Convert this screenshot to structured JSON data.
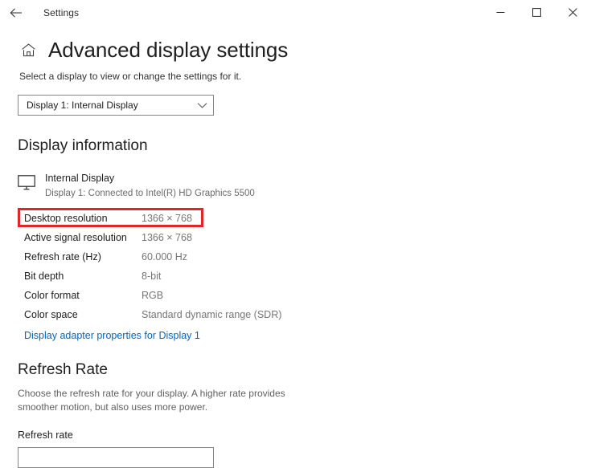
{
  "titlebar": {
    "back_icon": "back-arrow-icon",
    "app_title": "Settings",
    "minimize_label": "minimize-icon",
    "maximize_label": "maximize-icon",
    "close_label": "close-icon"
  },
  "header": {
    "home_icon": "home-icon",
    "title": "Advanced display settings",
    "subtitle": "Select a display to view or change the settings for it."
  },
  "display_selector": {
    "value": "Display 1: Internal Display",
    "chevron_icon": "chevron-down-icon"
  },
  "display_information": {
    "heading": "Display information",
    "monitor_icon": "monitor-icon",
    "display_name": "Internal Display",
    "connection": "Display 1: Connected to Intel(R) HD Graphics 5500",
    "rows": [
      {
        "label": "Desktop resolution",
        "value": "1366 × 768",
        "highlighted": true
      },
      {
        "label": "Active signal resolution",
        "value": "1366 × 768",
        "highlighted": false
      },
      {
        "label": "Refresh rate (Hz)",
        "value": "60.000 Hz",
        "highlighted": false
      },
      {
        "label": "Bit depth",
        "value": "8-bit",
        "highlighted": false
      },
      {
        "label": "Color format",
        "value": "RGB",
        "highlighted": false
      },
      {
        "label": "Color space",
        "value": "Standard dynamic range (SDR)",
        "highlighted": false
      }
    ],
    "adapter_link": "Display adapter properties for Display 1"
  },
  "refresh_rate": {
    "heading": "Refresh Rate",
    "description": "Choose the refresh rate for your display. A higher rate provides smoother motion, but also uses more power.",
    "field_label": "Refresh rate"
  },
  "colors": {
    "highlight_red": "#e02626",
    "link_blue": "#0b63b8",
    "value_gray": "#767676"
  }
}
